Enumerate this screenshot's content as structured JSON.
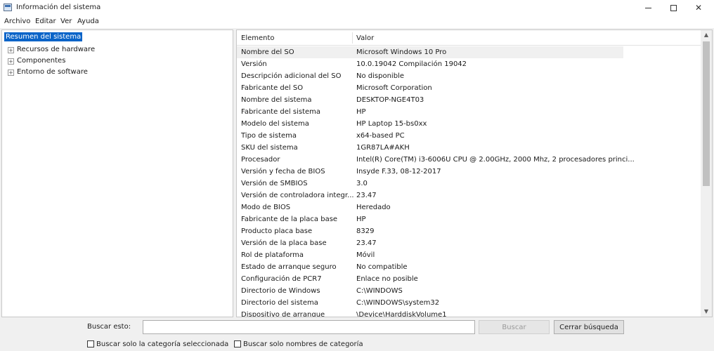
{
  "window": {
    "title": "Información del sistema",
    "controls": {
      "minimize": "—",
      "maximize": "☐",
      "close": "✕"
    }
  },
  "menu": {
    "items": [
      "Archivo",
      "Editar",
      "Ver",
      "Ayuda"
    ]
  },
  "tree": {
    "root": "Resumen del sistema",
    "children": [
      "Recursos de hardware",
      "Componentes",
      "Entorno de software"
    ],
    "expander_symbol": "+"
  },
  "table": {
    "columns": [
      "Elemento",
      "Valor"
    ],
    "selected_row": 0,
    "rows": [
      [
        "Nombre del SO",
        "Microsoft Windows 10 Pro"
      ],
      [
        "Versión",
        "10.0.19042 Compilación 19042"
      ],
      [
        "Descripción adicional del SO",
        "No disponible"
      ],
      [
        "Fabricante del SO",
        "Microsoft Corporation"
      ],
      [
        "Nombre del sistema",
        "DESKTOP-NGE4T03"
      ],
      [
        "Fabricante del sistema",
        "HP"
      ],
      [
        "Modelo del sistema",
        "HP Laptop 15-bs0xx"
      ],
      [
        "Tipo de sistema",
        "x64-based PC"
      ],
      [
        "SKU del sistema",
        "1GR87LA#AKH"
      ],
      [
        "Procesador",
        "Intel(R) Core(TM) i3-6006U CPU @ 2.00GHz, 2000 Mhz, 2 procesadores princi..."
      ],
      [
        "Versión y fecha de BIOS",
        "Insyde F.33, 08-12-2017"
      ],
      [
        "Versión de SMBIOS",
        "3.0"
      ],
      [
        "Versión de controladora integr...",
        "23.47"
      ],
      [
        "Modo de BIOS",
        "Heredado"
      ],
      [
        "Fabricante de la placa base",
        "HP"
      ],
      [
        "Producto placa base",
        "8329"
      ],
      [
        "Versión de la placa base",
        "23.47"
      ],
      [
        "Rol de plataforma",
        "Móvil"
      ],
      [
        "Estado de arranque seguro",
        "No compatible"
      ],
      [
        "Configuración de PCR7",
        "Enlace no posible"
      ],
      [
        "Directorio de Windows",
        "C:\\WINDOWS"
      ],
      [
        "Directorio del sistema",
        "C:\\WINDOWS\\system32"
      ],
      [
        "Dispositivo de arranque",
        "\\Device\\HarddiskVolume1"
      ]
    ]
  },
  "scrollbar": {
    "up_arrow": "▲",
    "down_arrow": "▼"
  },
  "search": {
    "label": "Buscar esto:",
    "value": "",
    "placeholder": "",
    "search_button": "Buscar",
    "close_button": "Cerrar búsqueda",
    "option_selected_category": "Buscar solo la categoría seleccionada",
    "option_category_names": "Buscar solo nombres de categoría",
    "option_selected_category_checked": false,
    "option_category_names_checked": false
  },
  "colors": {
    "selection": "#0a64c8",
    "row_highlight": "#f0f0f0",
    "disabled_text": "#9a9a9a"
  }
}
